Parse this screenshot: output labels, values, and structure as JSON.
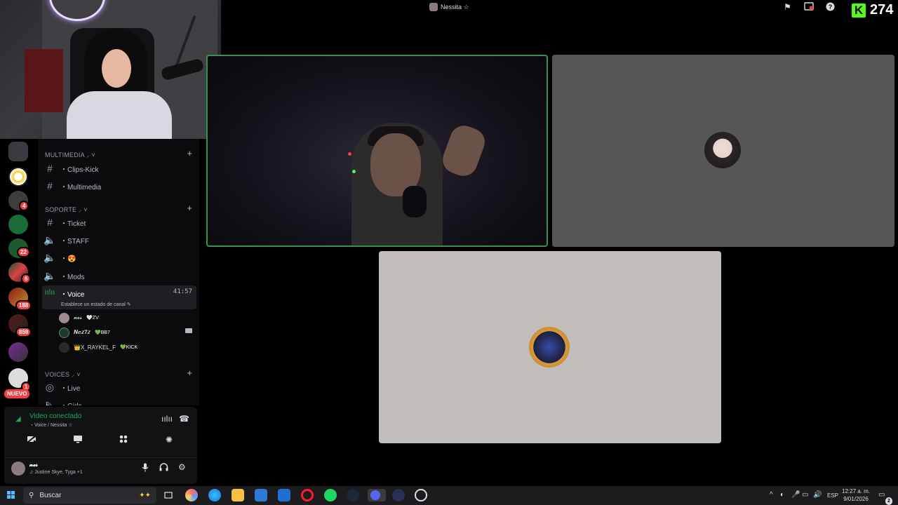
{
  "stream": {
    "kick_icon_letter": "K",
    "viewer_count": "274",
    "accent": "#53fc18"
  },
  "call": {
    "title": "Nessita ☆"
  },
  "sidebar": {
    "categories": {
      "multimedia": "MULTIMEDIA ⸝ ˅",
      "soporte": "SOPORTE ⸝ ˅",
      "voices": "VOICES ⸝ ˅"
    },
    "channels": [
      {
        "label": "・Clips-Kick",
        "icon": "hash-icon"
      },
      {
        "label": "・Multimedia",
        "icon": "hash-icon"
      },
      {
        "label": "・Ticket",
        "icon": "hash-icon"
      },
      {
        "label": "・STAFF",
        "icon": "speaker-lock-icon"
      },
      {
        "label": "・😍",
        "icon": "speaker-lock-icon"
      },
      {
        "label": "・Mods",
        "icon": "speaker-lock-icon"
      },
      {
        "label": "・Voice",
        "icon": "voice-active-icon",
        "timer": "41:57"
      },
      {
        "label": "・Live",
        "icon": "stage-icon"
      },
      {
        "label": "・Girls",
        "icon": "speaker-icon"
      }
    ],
    "voice_status": "Establece un estado de canal ✎",
    "voice_users": [
      {
        "name": "𝓷𝓮𝓼",
        "tag": "🤍ZV"
      },
      {
        "name": "𝑵𝒆𝒛𝟕𝒛",
        "tag": "💚BB7"
      },
      {
        "name": "👑X_RAYKEL_F",
        "tag": "💚KICK"
      }
    ],
    "servers": [
      {
        "badge": ""
      },
      {
        "badge": ""
      },
      {
        "badge": "4"
      },
      {
        "badge": ""
      },
      {
        "badge": "22"
      },
      {
        "badge": "6"
      },
      {
        "badge": "188"
      },
      {
        "badge": "859"
      },
      {
        "badge": ""
      },
      {
        "badge": "1"
      }
    ],
    "new_label": "NUEVO"
  },
  "voice_panel": {
    "status": "Video conectado",
    "location": "・Voice / Nessita ☆",
    "user_name": "𝓷𝓮𝓼",
    "activity": "♫ Justine Skye, Tyga +1"
  },
  "taskbar": {
    "search_placeholder": "Buscar",
    "language": "ESP",
    "time": "12:27 a. m.",
    "date": "9/01/2026",
    "notifications": "2"
  },
  "colors": {
    "discord_bg": "#0b0b0d",
    "connected_green": "#23a55a",
    "badge_red": "#f23f43",
    "speaking_border": "#3c8e59"
  }
}
